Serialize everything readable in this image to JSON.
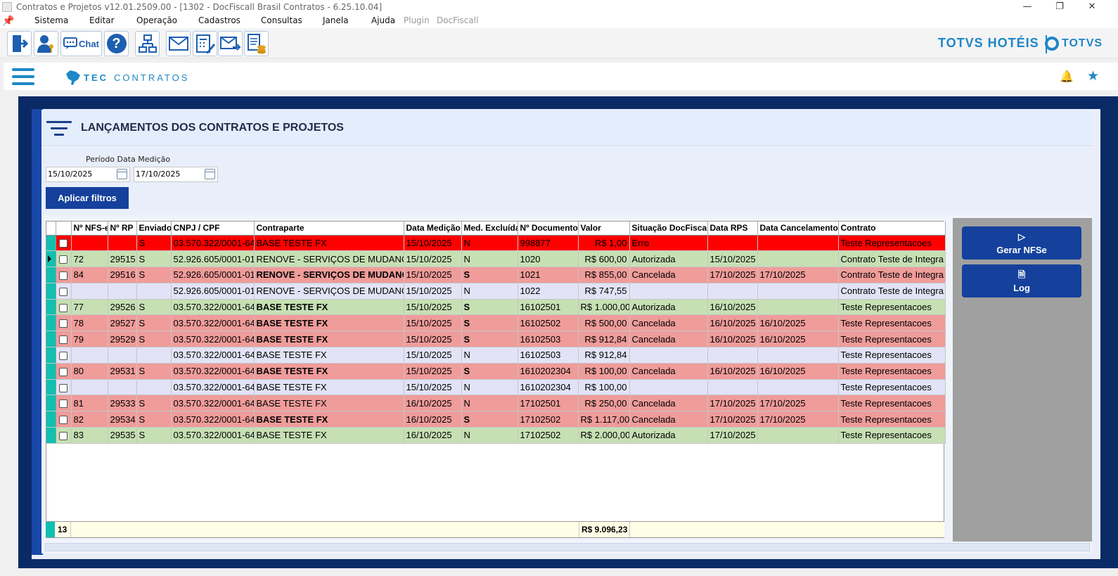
{
  "window": {
    "title": "Contratos e Projetos v12.01.2509.00 - [1302 - DocFiscall Brasil Contratos - 6.25.10.04]",
    "controls": [
      "—",
      "❐",
      "✕"
    ]
  },
  "menu": {
    "items": [
      "Sistema",
      "Editar",
      "Operação",
      "Cadastros",
      "Consultas",
      "Janela",
      "Ajuda"
    ],
    "disabled_items": [
      "Plugin",
      "DocFiscall"
    ]
  },
  "toolbar": {
    "chat_label": "Chat",
    "help_label": "?",
    "brand_hotel": "TOTVS HOTÉIS",
    "brand_totvs": "TOTVS"
  },
  "appbar": {
    "logo_text_1": "TEC",
    "logo_text_2": "CONTRATOS"
  },
  "page": {
    "title": "LANÇAMENTOS DOS CONTRATOS E PROJETOS",
    "period_label": "Período Data Medição",
    "date_from": "15/10/2025",
    "date_to": "17/10/2025",
    "apply_label": "Aplicar filtros"
  },
  "grid": {
    "columns": [
      "Nº NFS-e",
      "Nº RP",
      "Enviado",
      "CNPJ / CPF",
      "Contraparte",
      "Data Medição",
      "Med. Excluída",
      "Nº Documento",
      "Valor",
      "Situação DocFiscall",
      "Data RPS",
      "Data Cancelamento",
      "Contrato"
    ],
    "rows": [
      {
        "style": "red",
        "nfse": "",
        "rp": "",
        "env": "S",
        "cnpj": "03.570.322/0001-64",
        "contra": "BASE TESTE FX",
        "contra_bold": false,
        "data": "15/10/2025",
        "exc": "N",
        "exc_bold": false,
        "doc": "998877",
        "valor": "R$ 1,00",
        "sit": "Erro",
        "rps": "",
        "canc": "",
        "contrato": "Teste Representacoes",
        "current": false
      },
      {
        "style": "green",
        "nfse": "72",
        "rp": "29515",
        "env": "S",
        "cnpj": "52.926.605/0001-01",
        "contra": "RENOVE - SERVIÇOS DE MUDANCA",
        "contra_bold": false,
        "data": "15/10/2025",
        "exc": "N",
        "exc_bold": false,
        "doc": "1020",
        "valor": "R$ 600,00",
        "sit": "Autorizada",
        "rps": "15/10/2025",
        "canc": "",
        "contrato": "Contrato Teste de Integra",
        "current": true
      },
      {
        "style": "pink",
        "nfse": "84",
        "rp": "29516",
        "env": "S",
        "cnpj": "52.926.605/0001-01",
        "contra": "RENOVE - SERVIÇOS DE MUDANCA",
        "contra_bold": true,
        "data": "15/10/2025",
        "exc": "S",
        "exc_bold": true,
        "doc": "1021",
        "valor": "R$ 855,00",
        "sit": "Cancelada",
        "rps": "17/10/2025",
        "canc": "17/10/2025",
        "contrato": "Contrato Teste de Integra",
        "current": false
      },
      {
        "style": "lav",
        "nfse": "",
        "rp": "",
        "env": "",
        "cnpj": "52.926.605/0001-01",
        "contra": "RENOVE - SERVIÇOS DE MUDANCA",
        "contra_bold": false,
        "data": "15/10/2025",
        "exc": "N",
        "exc_bold": false,
        "doc": "1022",
        "valor": "R$ 747,55",
        "sit": "",
        "rps": "",
        "canc": "",
        "contrato": "Contrato Teste de Integra",
        "current": false
      },
      {
        "style": "green",
        "nfse": "77",
        "rp": "29526",
        "env": "S",
        "cnpj": "03.570.322/0001-64",
        "contra": "BASE TESTE FX",
        "contra_bold": true,
        "data": "15/10/2025",
        "exc": "S",
        "exc_bold": true,
        "doc": "16102501",
        "valor": "R$ 1.000,00",
        "sit": "Autorizada",
        "rps": "16/10/2025",
        "canc": "",
        "contrato": "Teste Representacoes",
        "current": false
      },
      {
        "style": "pink",
        "nfse": "78",
        "rp": "29527",
        "env": "S",
        "cnpj": "03.570.322/0001-64",
        "contra": "BASE TESTE FX",
        "contra_bold": true,
        "data": "15/10/2025",
        "exc": "S",
        "exc_bold": true,
        "doc": "16102502",
        "valor": "R$ 500,00",
        "sit": "Cancelada",
        "rps": "16/10/2025",
        "canc": "16/10/2025",
        "contrato": "Teste Representacoes",
        "current": false
      },
      {
        "style": "pink",
        "nfse": "79",
        "rp": "29529",
        "env": "S",
        "cnpj": "03.570.322/0001-64",
        "contra": "BASE TESTE FX",
        "contra_bold": true,
        "data": "15/10/2025",
        "exc": "S",
        "exc_bold": true,
        "doc": "16102503",
        "valor": "R$ 912,84",
        "sit": "Cancelada",
        "rps": "16/10/2025",
        "canc": "16/10/2025",
        "contrato": "Teste Representacoes",
        "current": false
      },
      {
        "style": "lav",
        "nfse": "",
        "rp": "",
        "env": "",
        "cnpj": "03.570.322/0001-64",
        "contra": "BASE TESTE FX",
        "contra_bold": false,
        "data": "15/10/2025",
        "exc": "N",
        "exc_bold": false,
        "doc": "16102503",
        "valor": "R$ 912,84",
        "sit": "",
        "rps": "",
        "canc": "",
        "contrato": "Teste Representacoes",
        "current": false
      },
      {
        "style": "pink",
        "nfse": "80",
        "rp": "29531",
        "env": "S",
        "cnpj": "03.570.322/0001-64",
        "contra": "BASE TESTE FX",
        "contra_bold": true,
        "data": "15/10/2025",
        "exc": "S",
        "exc_bold": true,
        "doc": "1610202304",
        "valor": "R$ 100,00",
        "sit": "Cancelada",
        "rps": "16/10/2025",
        "canc": "16/10/2025",
        "contrato": "Teste Representacoes",
        "current": false
      },
      {
        "style": "lav",
        "nfse": "",
        "rp": "",
        "env": "",
        "cnpj": "03.570.322/0001-64",
        "contra": "BASE TESTE FX",
        "contra_bold": false,
        "data": "15/10/2025",
        "exc": "N",
        "exc_bold": false,
        "doc": "1610202304",
        "valor": "R$ 100,00",
        "sit": "",
        "rps": "",
        "canc": "",
        "contrato": "Teste Representacoes",
        "current": false
      },
      {
        "style": "pink",
        "nfse": "81",
        "rp": "29533",
        "env": "S",
        "cnpj": "03.570.322/0001-64",
        "contra": "BASE TESTE FX",
        "contra_bold": false,
        "data": "16/10/2025",
        "exc": "N",
        "exc_bold": false,
        "doc": "17102501",
        "valor": "R$ 250,00",
        "sit": "Cancelada",
        "rps": "17/10/2025",
        "canc": "17/10/2025",
        "contrato": "Teste Representacoes",
        "current": false
      },
      {
        "style": "pink",
        "nfse": "82",
        "rp": "29534",
        "env": "S",
        "cnpj": "03.570.322/0001-64",
        "contra": "BASE TESTE FX",
        "contra_bold": true,
        "data": "16/10/2025",
        "exc": "S",
        "exc_bold": true,
        "doc": "17102502",
        "valor": "R$ 1.117,00",
        "sit": "Cancelada",
        "rps": "17/10/2025",
        "canc": "17/10/2025",
        "contrato": "Teste Representacoes",
        "current": false
      },
      {
        "style": "green",
        "nfse": "83",
        "rp": "29535",
        "env": "S",
        "cnpj": "03.570.322/0001-64",
        "contra": "BASE TESTE FX",
        "contra_bold": false,
        "data": "16/10/2025",
        "exc": "N",
        "exc_bold": false,
        "doc": "17102502",
        "valor": "R$ 2.000,00",
        "sit": "Autorizada",
        "rps": "17/10/2025",
        "canc": "",
        "contrato": "Teste Representacoes",
        "current": false
      }
    ],
    "total_count": "13",
    "total_value": "R$ 9.096,23"
  },
  "side": {
    "gerar_label": "Gerar NFSe",
    "log_label": "Log"
  },
  "colors": {
    "accent": "#15419c",
    "frame": "#0a2a66",
    "brand": "#1e86c8",
    "row_error": "#ff0000",
    "row_authorized": "#c6e0b4",
    "row_cancelled": "#ef9c9a",
    "row_pending": "#e2e3f6",
    "selector": "#10c0b0"
  }
}
